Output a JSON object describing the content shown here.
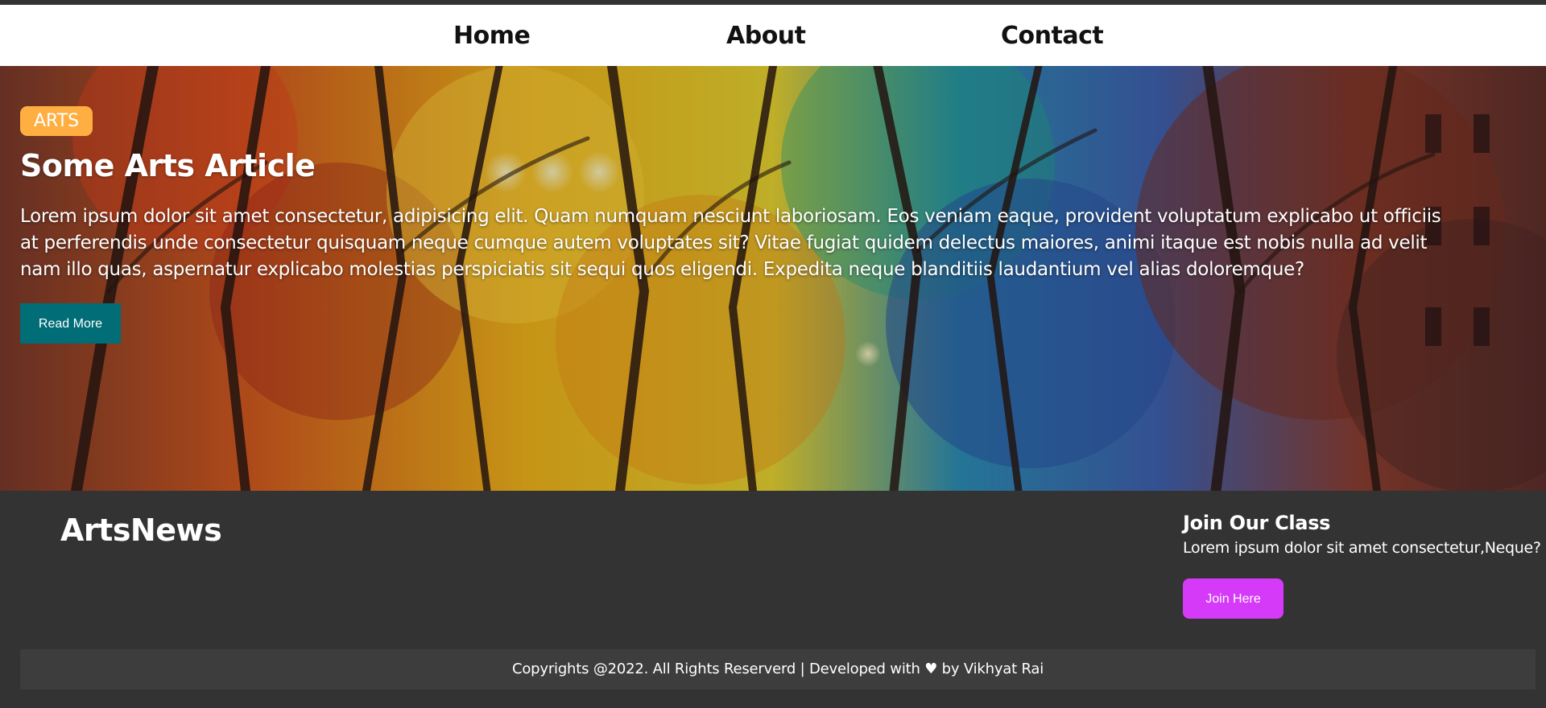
{
  "nav": {
    "home": "Home",
    "about": "About",
    "contact": "Contact"
  },
  "article": {
    "category": "ARTS",
    "title": "Some Arts Article",
    "body": "Lorem ipsum dolor sit amet consectetur, adipisicing elit. Quam numquam nesciunt laboriosam. Eos veniam eaque, provident voluptatum explicabo ut officiis at perferendis unde consectetur quisquam neque cumque autem voluptates sit? Vitae fugiat quidem delectus maiores, animi itaque est nobis nulla ad velit nam illo quas, aspernatur explicabo molestias perspiciatis sit sequi quos eligendi. Expedita neque blanditiis laudantium vel alias doloremque?",
    "read_more": "Read More"
  },
  "footer": {
    "brand": "ArtsNews",
    "join_title": "Join Our Class",
    "join_text": "Lorem ipsum dolor sit amet consectetur,Neque?",
    "join_button": "Join Here",
    "copyright": "Copyrights @2022. All Rights Reserverd | Developed with ♥ by Vikhyat Rai"
  },
  "colors": {
    "badge": "#ffae42",
    "read_more": "#006d77",
    "join_button": "#d63af9",
    "footer_bg": "#333333"
  },
  "icons": {
    "hero_image": "abstract-painted-forest-image"
  }
}
